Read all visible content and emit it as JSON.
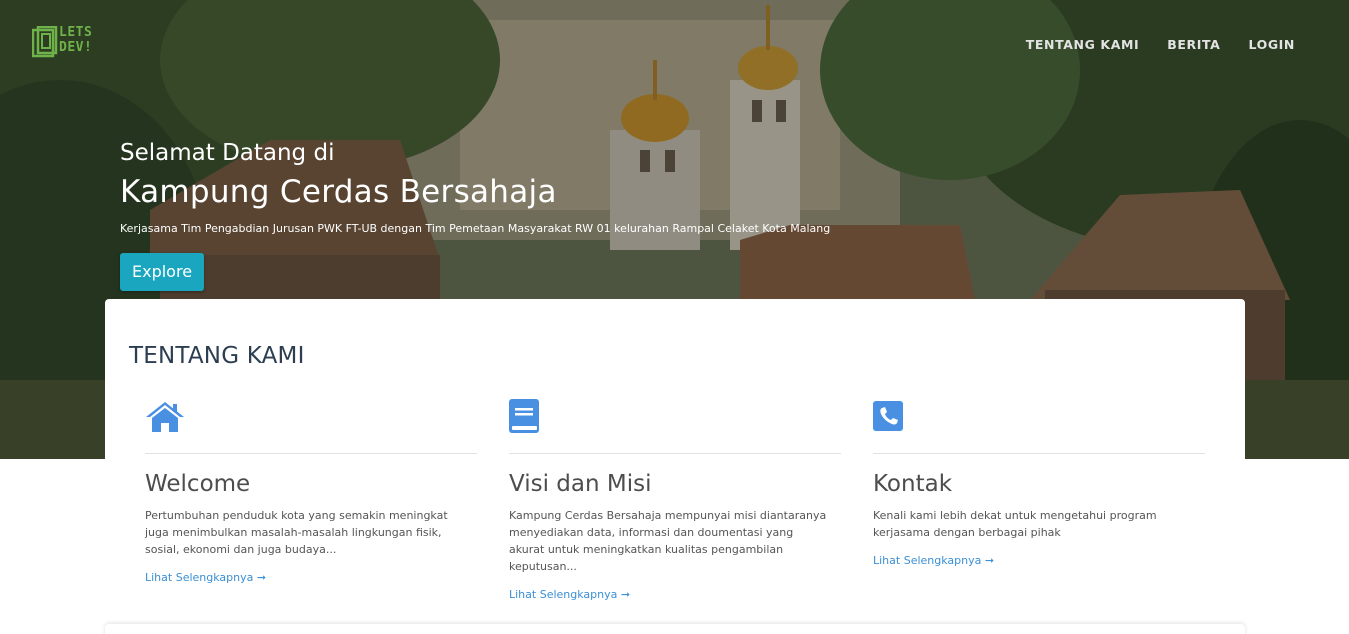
{
  "brand": {
    "logo_text_line1": "LETS",
    "logo_text_line2": "DEV!",
    "color": "#6fb24a"
  },
  "nav": {
    "items": [
      {
        "label": "TENTANG KAMI"
      },
      {
        "label": "BERITA"
      },
      {
        "label": "LOGIN"
      }
    ]
  },
  "hero": {
    "greeting": "Selamat Datang di",
    "title": "Kampung Cerdas Bersahaja",
    "description": "Kerjasama Tim Pengabdian Jurusan PWK FT-UB dengan Tim Pemetaan Masyarakat RW 01 kelurahan Rampal Celaket Kota Malang",
    "button_label": "Explore",
    "button_color": "#1ba6c0"
  },
  "about": {
    "section_title": "TENTANG KAMI",
    "accent_color": "#4a90e2",
    "columns": [
      {
        "icon": "home-icon",
        "title": "Welcome",
        "text": " Pertumbuhan penduduk kota yang semakin meningkat juga menimbulkan masalah-masalah lingkungan fisik, sosial, ekonomi dan juga budaya...",
        "link": "Lihat Selengkapnya ➞"
      },
      {
        "icon": "book-icon",
        "title": "Visi dan Misi",
        "text": " Kampung Cerdas Bersahaja mempunyai misi diantaranya menyediakan data, informasi dan doumentasi yang akurat untuk meningkatkan kualitas pengambilan keputusan...",
        "link": "Lihat Selengkapnya ➞"
      },
      {
        "icon": "phone-icon",
        "title": "Kontak",
        "text": " Kenali kami lebih dekat untuk mengetahui program kerjasama dengan berbagai pihak",
        "link": "Lihat Selengkapnya ➞"
      }
    ]
  }
}
